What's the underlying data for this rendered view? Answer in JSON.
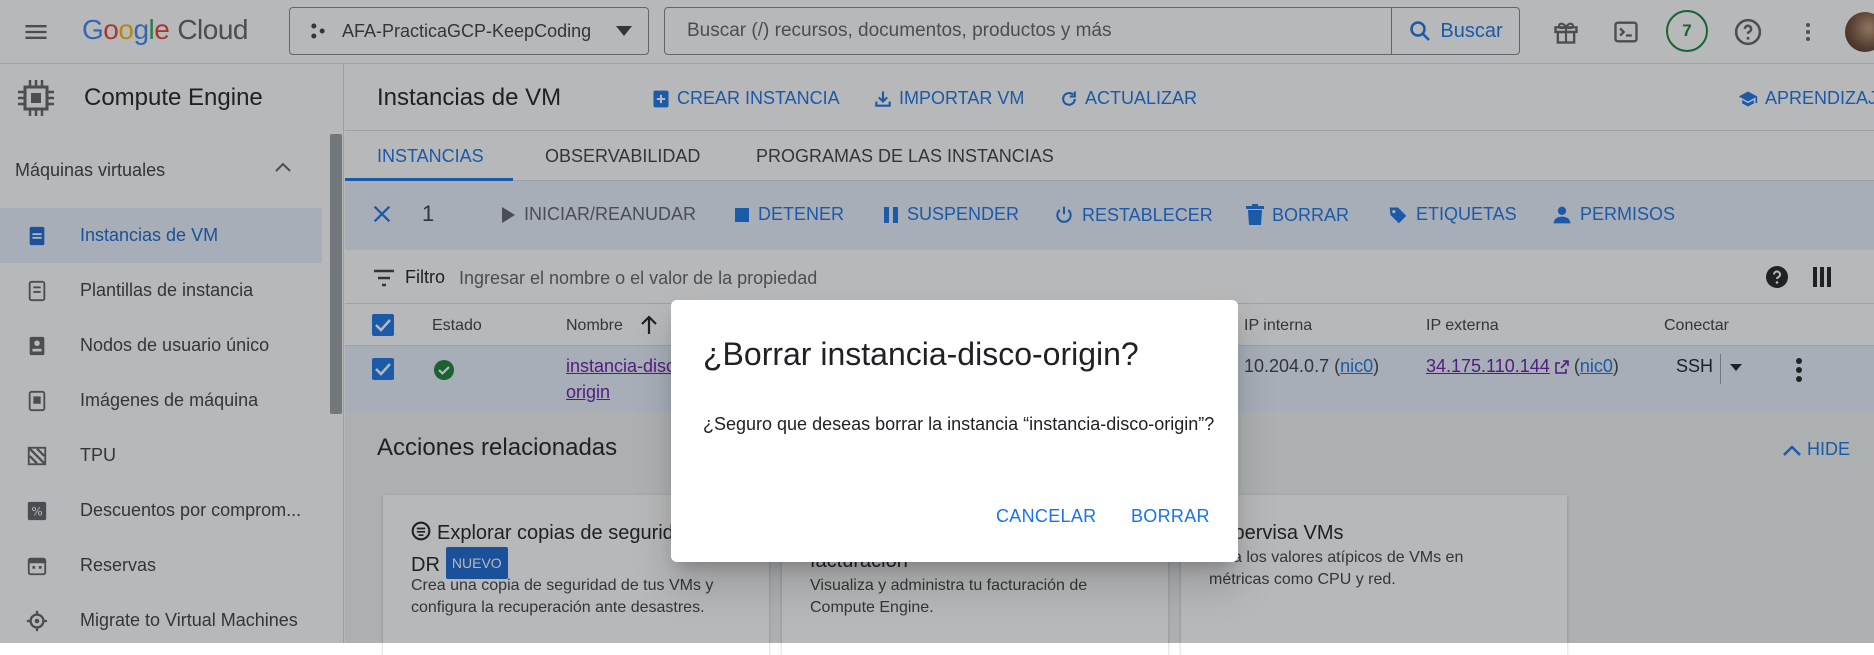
{
  "topbar": {
    "logo_letters": [
      "G",
      "o",
      "o",
      "g",
      "l",
      "e"
    ],
    "logo_cloud": "Cloud",
    "project": "AFA-PracticaGCP-KeepCoding",
    "search_placeholder": "Buscar (/) recursos, documentos, productos y más",
    "search_button": "Buscar",
    "notifications_count": "7"
  },
  "sidebar": {
    "product": "Compute Engine",
    "section": "Máquinas virtuales",
    "items": [
      {
        "label": "Instancias de VM",
        "icon": "vm-instance-icon",
        "active": true
      },
      {
        "label": "Plantillas de instancia",
        "icon": "template-icon"
      },
      {
        "label": "Nodos de usuario único",
        "icon": "sole-tenant-icon"
      },
      {
        "label": "Imágenes de máquina",
        "icon": "machine-image-icon"
      },
      {
        "label": "TPU",
        "icon": "tpu-icon"
      },
      {
        "label": "Descuentos por comprom...",
        "icon": "discount-icon"
      },
      {
        "label": "Reservas",
        "icon": "calendar-icon"
      },
      {
        "label": "Migrate to Virtual Machines",
        "icon": "migrate-icon"
      }
    ]
  },
  "page": {
    "title": "Instancias de VM",
    "actions": {
      "create": "CREAR INSTANCIA",
      "import": "IMPORTAR VM",
      "refresh": "ACTUALIZAR",
      "learn": "APRENDIZAJE"
    }
  },
  "tabs": [
    "INSTANCIAS",
    "OBSERVABILIDAD",
    "PROGRAMAS DE LAS INSTANCIAS"
  ],
  "actionbar": {
    "selected_count": "1",
    "start": "INICIAR/REANUDAR",
    "stop": "DETENER",
    "suspend": "SUSPENDER",
    "reset": "RESTABLECER",
    "delete": "BORRAR",
    "labels": "ETIQUETAS",
    "permissions": "PERMISOS"
  },
  "filter": {
    "label": "Filtro",
    "placeholder": "Ingresar el nombre o el valor de la propiedad"
  },
  "table": {
    "headers": {
      "status": "Estado",
      "name": "Nombre",
      "internal_ip": "IP interna",
      "external_ip": "IP externa",
      "connect": "Conectar"
    },
    "row": {
      "name_line1": "instancia-disco-",
      "name_line2": "origin",
      "internal_ip": "10.204.0.7",
      "internal_nic": "nic0",
      "external_ip": "34.175.110.144",
      "external_nic": "nic0",
      "connect": "SSH"
    }
  },
  "related": {
    "title": "Acciones relacionadas",
    "hide": "HIDE",
    "cards": [
      {
        "title_line1": "Explorar copias de seguridad",
        "title_line2": "DR",
        "badge": "NUEVO",
        "desc_line1": "Crea una copia de seguridad de tus VMs y",
        "desc_line2": "configura la recuperación ante desastres."
      },
      {
        "title_line1": "facturación",
        "desc_line1": "Visualiza y administra tu facturación de",
        "desc_line2": "Compute Engine."
      },
      {
        "title_line1": "Supervisa VMs",
        "desc_line1": "aliza los valores atípicos de VMs en",
        "desc_line2": "métricas como CPU y red."
      }
    ]
  },
  "dialog": {
    "title": "¿Borrar instancia-disco-origin?",
    "message": "¿Seguro que deseas borrar la instancia “instancia-disco-origin”?",
    "cancel": "CANCELAR",
    "confirm": "BORRAR"
  },
  "colors": {
    "primary": "#1a73e8",
    "selected_bg": "#e8f0fe",
    "success": "#188038",
    "visited_link": "#681da8"
  }
}
